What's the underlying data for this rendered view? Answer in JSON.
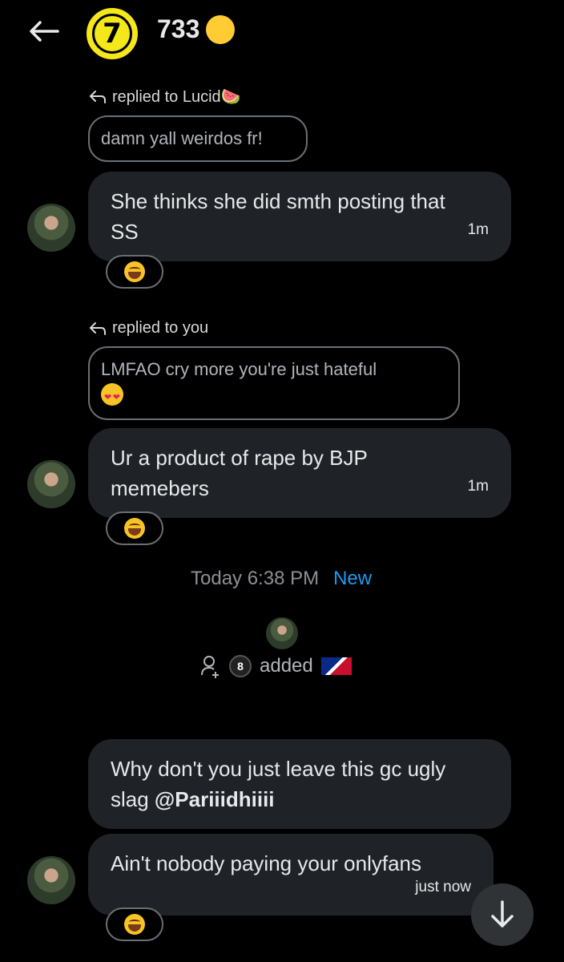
{
  "header": {
    "back_label": "Back",
    "group_icon_number": "7",
    "title": "733"
  },
  "messages": [
    {
      "reply_to": "replied to Lucid🍉",
      "quoted": "damn yall weirdos fr!",
      "text": "She thinks she did smth posting that SS",
      "time": "1m",
      "reaction": "😂"
    },
    {
      "reply_to": "replied to you",
      "quoted": "LMFAO cry more you're just hateful",
      "text": "Ur a product of rape by BJP memebers",
      "time": "1m",
      "reaction": "😂"
    }
  ],
  "divider": {
    "time": "Today 6:38 PM",
    "new_label": "New"
  },
  "system": {
    "ball": "8",
    "text": "added"
  },
  "messages2": [
    {
      "text_prefix": "Why don't you just leave this gc ugly slag ",
      "mention": "@Pariiidhiiii"
    },
    {
      "text": "Ain't nobody paying your onlyfans",
      "time": "just now",
      "reaction": "😂"
    }
  ],
  "colors": {
    "background": "#000000",
    "bubble": "#1f2226",
    "accent": "#1d9bf0",
    "group_icon": "#f4e71a"
  },
  "icons": [
    "back-arrow-icon",
    "reply-arrow-icon",
    "add-user-icon",
    "arrow-down-icon"
  ]
}
